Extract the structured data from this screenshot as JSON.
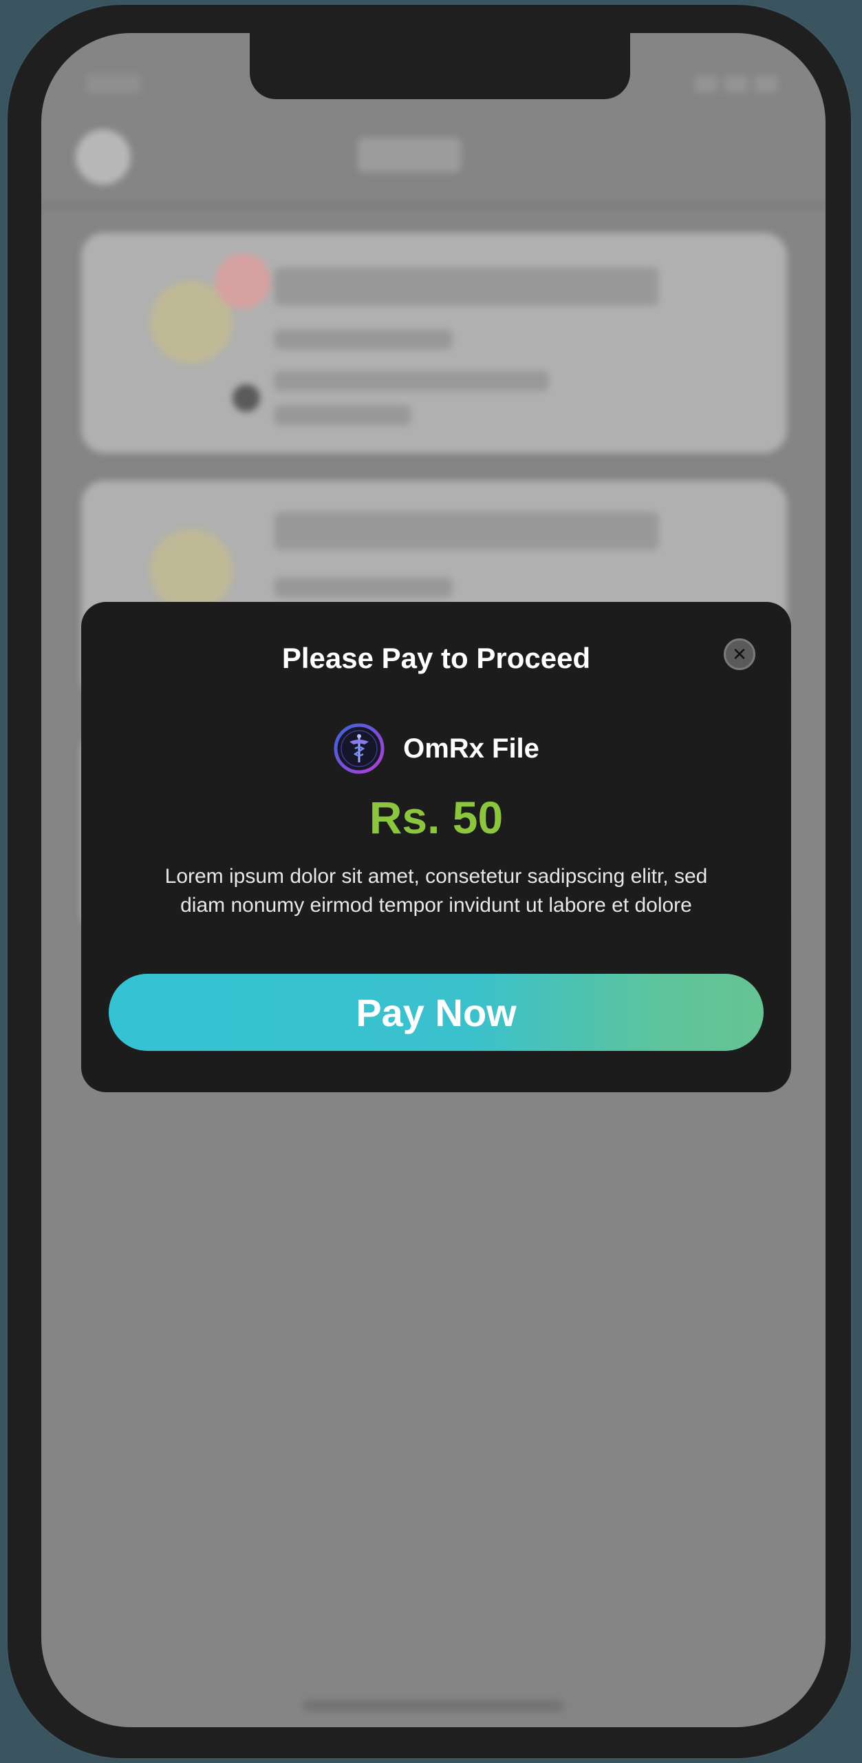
{
  "modal": {
    "title": "Please Pay to Proceed",
    "close_icon": "close-icon",
    "product": {
      "icon": "omrx-logo-icon",
      "name": "OmRx File"
    },
    "price": "Rs. 50",
    "description": "Lorem ipsum dolor sit amet, consetetur sadipscing elitr, sed diam nonumy eirmod tempor invidunt ut labore et dolore",
    "pay_button_label": "Pay Now"
  },
  "colors": {
    "price": "#8cc63f",
    "modal_background": "#1c1c1c",
    "overlay": "#858585",
    "pay_button_start": "#35c2d3",
    "pay_button_end": "#66c393"
  }
}
